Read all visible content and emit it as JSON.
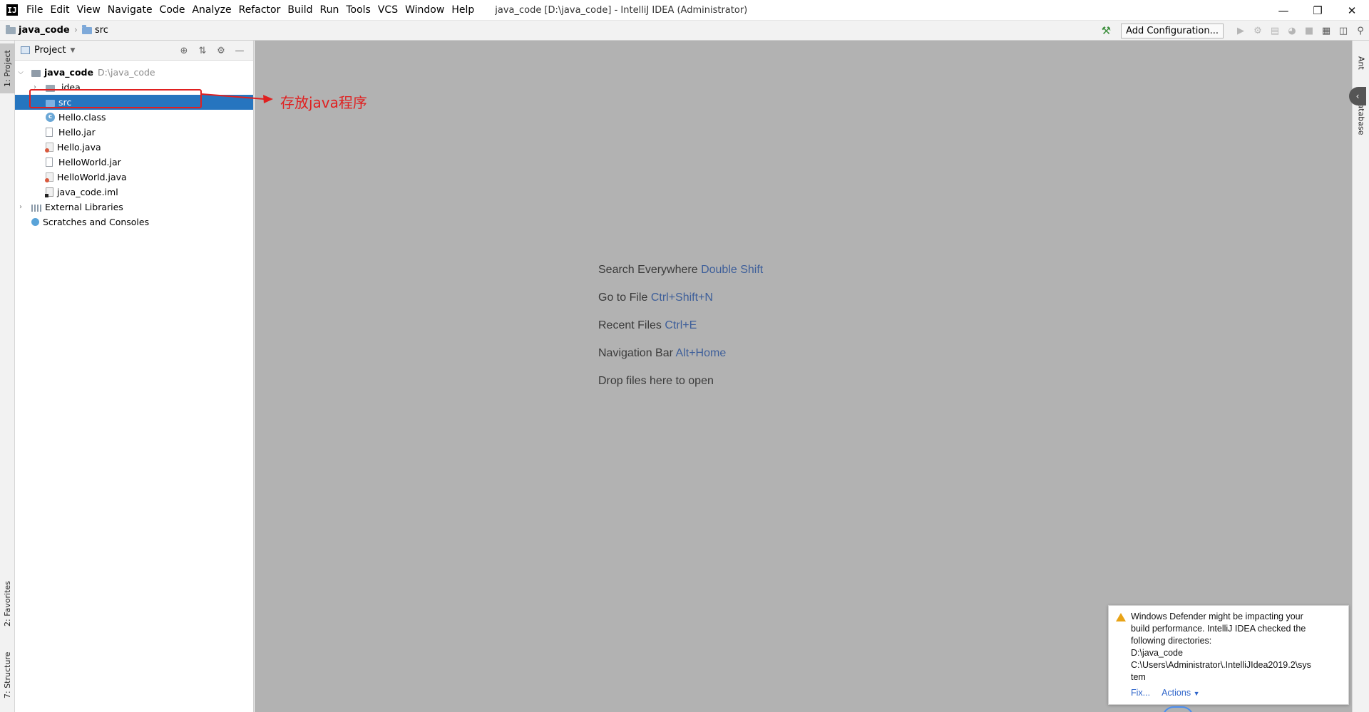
{
  "title_bar": {
    "app_logo_text": "IJ",
    "menu": [
      "File",
      "Edit",
      "View",
      "Navigate",
      "Code",
      "Analyze",
      "Refactor",
      "Build",
      "Run",
      "Tools",
      "VCS",
      "Window",
      "Help"
    ],
    "window_title": "java_code [D:\\java_code] - IntelliJ IDEA (Administrator)",
    "controls": {
      "minimize": "—",
      "restore": "❐",
      "close": "✕"
    }
  },
  "nav_bar": {
    "breadcrumb": [
      "java_code",
      "src"
    ],
    "add_configuration_label": "Add Configuration...",
    "toolbar_icons": [
      "build-hammer-icon",
      "run-icon",
      "debug-icon",
      "coverage-icon",
      "profile-icon",
      "stop-icon",
      "project-structure-icon",
      "sdk-icon",
      "search-everywhere-icon"
    ]
  },
  "left_stripe": {
    "project_tab": "1: Project",
    "favorites_tab": "2: Favorites",
    "structure_tab": "7: Structure"
  },
  "right_stripe": {
    "ant_tab": "Ant",
    "database_tab": "Database"
  },
  "project_panel": {
    "title": "Project",
    "tree": [
      {
        "label": "java_code",
        "hint": "D:\\java_code",
        "icon": "project-folder-icon",
        "level": 0,
        "expanded": true
      },
      {
        "label": ".idea",
        "icon": "folder-icon",
        "level": 1,
        "expanded": false
      },
      {
        "label": "src",
        "icon": "source-folder-icon",
        "level": 1,
        "selected": true
      },
      {
        "label": "Hello.class",
        "icon": "class-file-icon",
        "level": 1
      },
      {
        "label": "Hello.jar",
        "icon": "jar-file-icon",
        "level": 1
      },
      {
        "label": "Hello.java",
        "icon": "java-file-icon",
        "level": 1
      },
      {
        "label": "HelloWorld.jar",
        "icon": "jar-file-icon",
        "level": 1
      },
      {
        "label": "HelloWorld.java",
        "icon": "java-file-icon",
        "level": 1
      },
      {
        "label": "java_code.iml",
        "icon": "iml-file-icon",
        "level": 1
      },
      {
        "label": "External Libraries",
        "icon": "libraries-icon",
        "level": 0,
        "expanded": false
      },
      {
        "label": "Scratches and Consoles",
        "icon": "scratches-icon",
        "level": 0
      }
    ]
  },
  "annotation": {
    "text": "存放java程序",
    "color": "#e02020"
  },
  "editor_hints": [
    {
      "text": "Search Everywhere",
      "key": "Double Shift"
    },
    {
      "text": "Go to File",
      "key": "Ctrl+Shift+N"
    },
    {
      "text": "Recent Files",
      "key": "Ctrl+E"
    },
    {
      "text": "Navigation Bar",
      "key": "Alt+Home"
    },
    {
      "text": "Drop files here to open",
      "key": ""
    }
  ],
  "notification": {
    "lines": [
      "Windows Defender might be impacting your",
      "build performance. IntelliJ IDEA checked the",
      "following directories:",
      "D:\\java_code",
      "C:\\Users\\Administrator\\.IntelliJIdea2019.2\\sys",
      "tem"
    ],
    "fix_label": "Fix...",
    "actions_label": "Actions"
  },
  "colors": {
    "selection": "#2675bf",
    "editor_background": "#b2b2b2",
    "hint_key": "#3e5f9a",
    "link": "#2f65ca"
  }
}
